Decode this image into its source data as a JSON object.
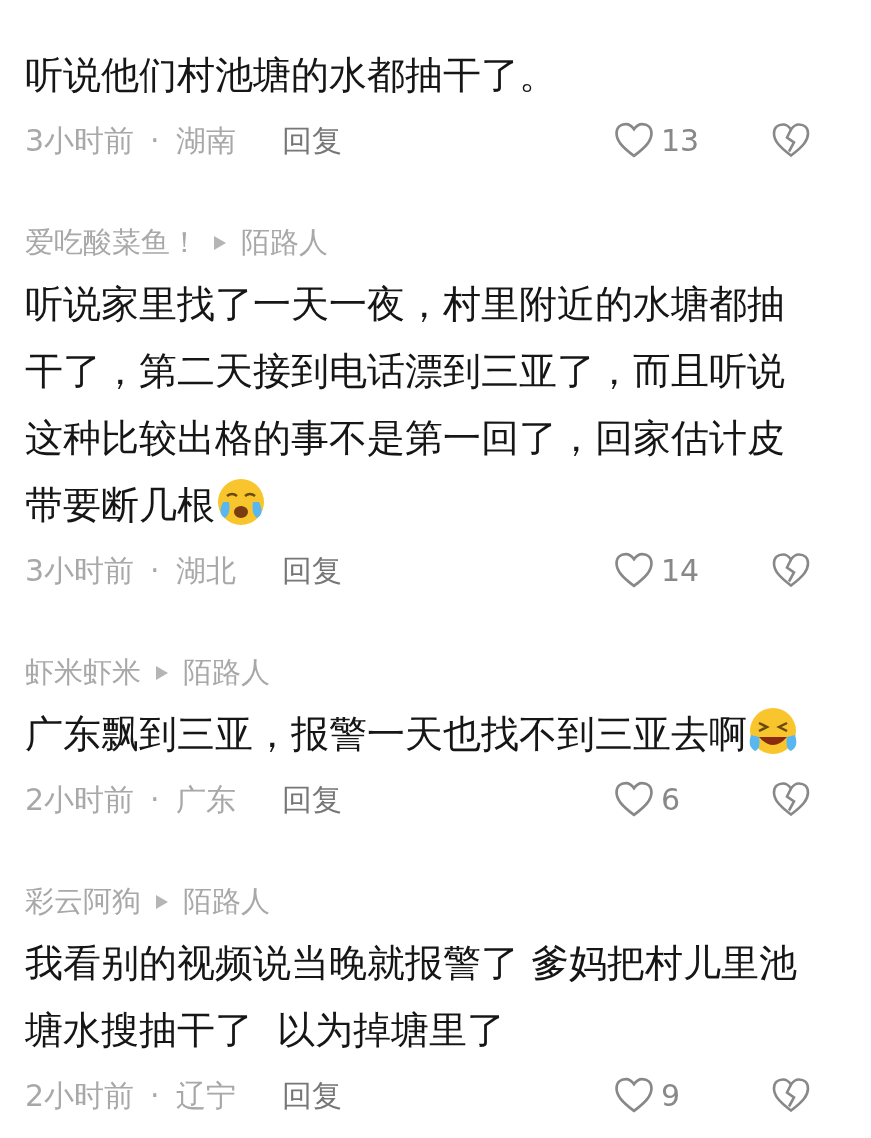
{
  "comments": [
    {
      "text": "听说他们村池塘的水都抽干了。",
      "time": "3小时前",
      "separator": "·",
      "region": "湖南",
      "reply": "回复",
      "likes": "13"
    },
    {
      "user": "爱吃酸菜鱼！",
      "tag": "陌路人",
      "text": "听说家里找了一天一夜，村里附近的水塘都抽干了，第二天接到电话漂到三亚了，而且听说这种比较出格的事不是第一回了，回家估计皮带要断几根",
      "emoji": {
        "kind": "crying"
      },
      "time": "3小时前",
      "separator": "·",
      "region": "湖北",
      "reply": "回复",
      "likes": "14"
    },
    {
      "user": "虾米虾米",
      "tag": "陌路人",
      "text": "广东飘到三亚，报警一天也找不到三亚去啊",
      "emoji": {
        "kind": "laughing"
      },
      "time": "2小时前",
      "separator": "·",
      "region": "广东",
      "reply": "回复",
      "likes": "6"
    },
    {
      "user": "彩云阿狗",
      "tag": "陌路人",
      "text": "我看别的视频说当晚就报警了 爹妈把村儿里池塘水搜抽干了  以为掉塘里了",
      "time": "2小时前",
      "separator": "·",
      "region": "辽宁",
      "reply": "回复",
      "likes": "9"
    }
  ]
}
